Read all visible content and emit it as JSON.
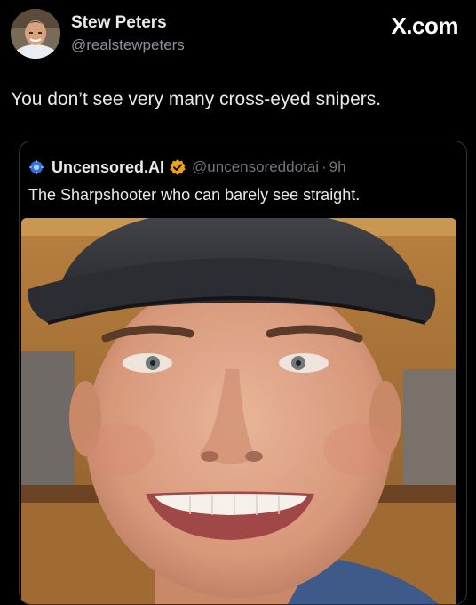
{
  "post": {
    "author_name": "Stew Peters",
    "author_handle": "@realstewpeters",
    "text": "You don’t see very many cross-eyed snipers."
  },
  "watermark": "X.com",
  "quote": {
    "author_name": "Uncensored.AI",
    "author_handle": "@uncensoreddotai",
    "separator": "·",
    "time": "9h",
    "text": "The Sharpshooter who can barely see straight.",
    "verified": true,
    "badge_color": "#e8a317"
  },
  "colors": {
    "background": "#000000",
    "primary_text": "#e7e9ea",
    "secondary_text": "#71767b",
    "card_border": "#2f3336"
  }
}
